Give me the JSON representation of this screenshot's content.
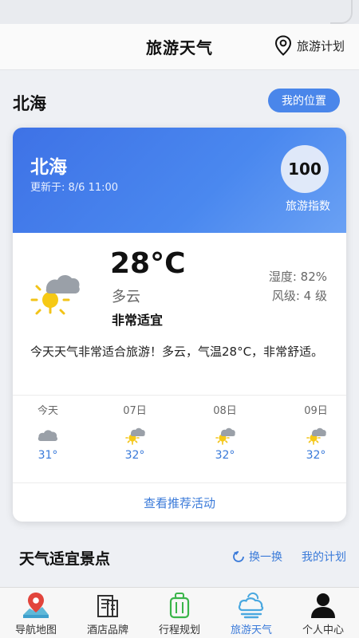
{
  "header": {
    "title": "旅游天气",
    "plan_label": "旅游计划"
  },
  "location": {
    "city": "北海",
    "my_location_label": "我的位置"
  },
  "weather_card": {
    "city": "北海",
    "updated": "更新于: 8/6 11:00",
    "score": "100",
    "score_label": "旅游指数",
    "temperature": "28°C",
    "condition": "多云",
    "suitability": "非常适宜",
    "humidity": "湿度: 82%",
    "wind": "风级: 4 级",
    "description": "今天天气非常适合旅游！多云，气温28°C，非常舒适。",
    "forecast": [
      {
        "day": "今天",
        "temp": "31°",
        "icon": "cloud-icon"
      },
      {
        "day": "07日",
        "temp": "32°",
        "icon": "partly-cloudy-icon"
      },
      {
        "day": "08日",
        "temp": "32°",
        "icon": "partly-cloudy-icon"
      },
      {
        "day": "09日",
        "temp": "32°",
        "icon": "partly-cloudy-icon"
      }
    ],
    "more_label": "查看推荐活动"
  },
  "spots": {
    "title": "天气适宜景点",
    "refresh_label": "换一换",
    "plan_label": "我的计划"
  },
  "tabbar": [
    {
      "label": "导航地图",
      "icon": "map-pin-icon"
    },
    {
      "label": "酒店品牌",
      "icon": "hotel-icon"
    },
    {
      "label": "行程规划",
      "icon": "luggage-icon"
    },
    {
      "label": "旅游天气",
      "icon": "weather-icon"
    },
    {
      "label": "个人中心",
      "icon": "person-icon"
    }
  ],
  "colors": {
    "accent": "#3a7ad9",
    "card_gradient_start": "#3e72e6",
    "card_gradient_end": "#6aa1f4"
  }
}
